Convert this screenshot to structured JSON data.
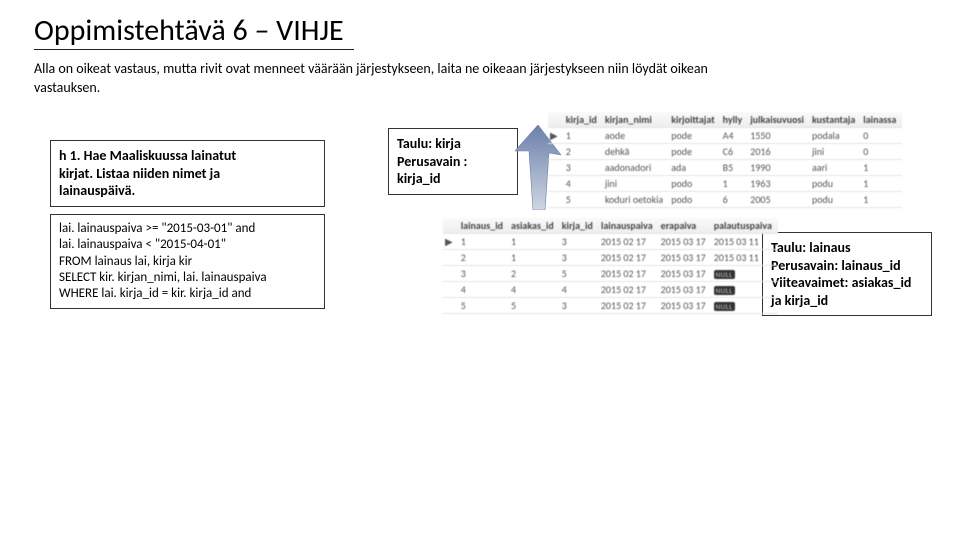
{
  "title": "Oppimistehtävä 6 – VIHJE",
  "subtitle_a": "Alla on oikeat vastaus, mutta rivit ovat menneet väärään järjestykseen, laita ne oikeaan järjestykseen niin löydät oikean",
  "subtitle_b": "vastauksen.",
  "h1_box": {
    "l1": "h 1. Hae Maaliskuussa lainatut",
    "l2": "kirjat. Listaa niiden nimet ja",
    "l3": "lainauspäivä."
  },
  "sql_box": {
    "l1": "lai. lainauspaiva >= \"2015-03-01\" and",
    "l2": "lai. lainauspaiva < \"2015-04-01\"",
    "l3": "FROM lainaus lai, kirja kir",
    "l4": "SELECT kir. kirjan_nimi, lai. lainauspaiva",
    "l5": "WHERE lai. kirja_id = kir. kirja_id and"
  },
  "kirja_box": {
    "l1": "Taulu: kirja",
    "l2": "Perusavain :",
    "l3": "kirja_id"
  },
  "lainaus_box": {
    "l1": "Taulu: lainaus",
    "l2": "Perusavain: lainaus_id",
    "l3": "Viiteavaimet: asiakas_id",
    "l4": "ja kirja_id"
  },
  "kirja_table": {
    "head": [
      "",
      "kirja_id",
      "kirjan_nimi",
      "kirjoittajat",
      "hylly",
      "julkaisuvuosi",
      "kustantaja",
      "lainassa"
    ],
    "rows": [
      [
        "▶",
        "1",
        "aode",
        "pode",
        "A4",
        "1550",
        "podala",
        "0"
      ],
      [
        "",
        "2",
        "dehkä",
        "pode",
        "C6",
        "2016",
        "jini",
        "0"
      ],
      [
        "",
        "3",
        "aadonadori",
        "ada",
        "B5",
        "1990",
        "aari",
        "1"
      ],
      [
        "",
        "4",
        "jini",
        "podo",
        "1",
        "1963",
        "podu",
        "1"
      ],
      [
        "",
        "5",
        "koduri oetokia",
        "podo",
        "6",
        "2005",
        "podu",
        "1"
      ]
    ]
  },
  "lainaus_table": {
    "head": [
      "",
      "lainaus_id",
      "asiakas_id",
      "kirja_id",
      "lainauspaiva",
      "erapaiva",
      "palautuspaiva"
    ],
    "null_label": "NULL",
    "rows": [
      [
        "▶",
        "1",
        "1",
        "3",
        "2015 02 17",
        "2015 03 17",
        "2015 03 11"
      ],
      [
        "",
        "2",
        "1",
        "3",
        "2015 02 17",
        "2015 03 17",
        "2015 03 11"
      ],
      [
        "",
        "3",
        "2",
        "5",
        "2015 02 17",
        "2015 03 17",
        "__NULL__"
      ],
      [
        "",
        "4",
        "4",
        "4",
        "2015 02 17",
        "2015 03 17",
        "__NULL__"
      ],
      [
        "",
        "5",
        "5",
        "3",
        "2015 02 17",
        "2015 03 17",
        "__NULL__"
      ]
    ]
  }
}
